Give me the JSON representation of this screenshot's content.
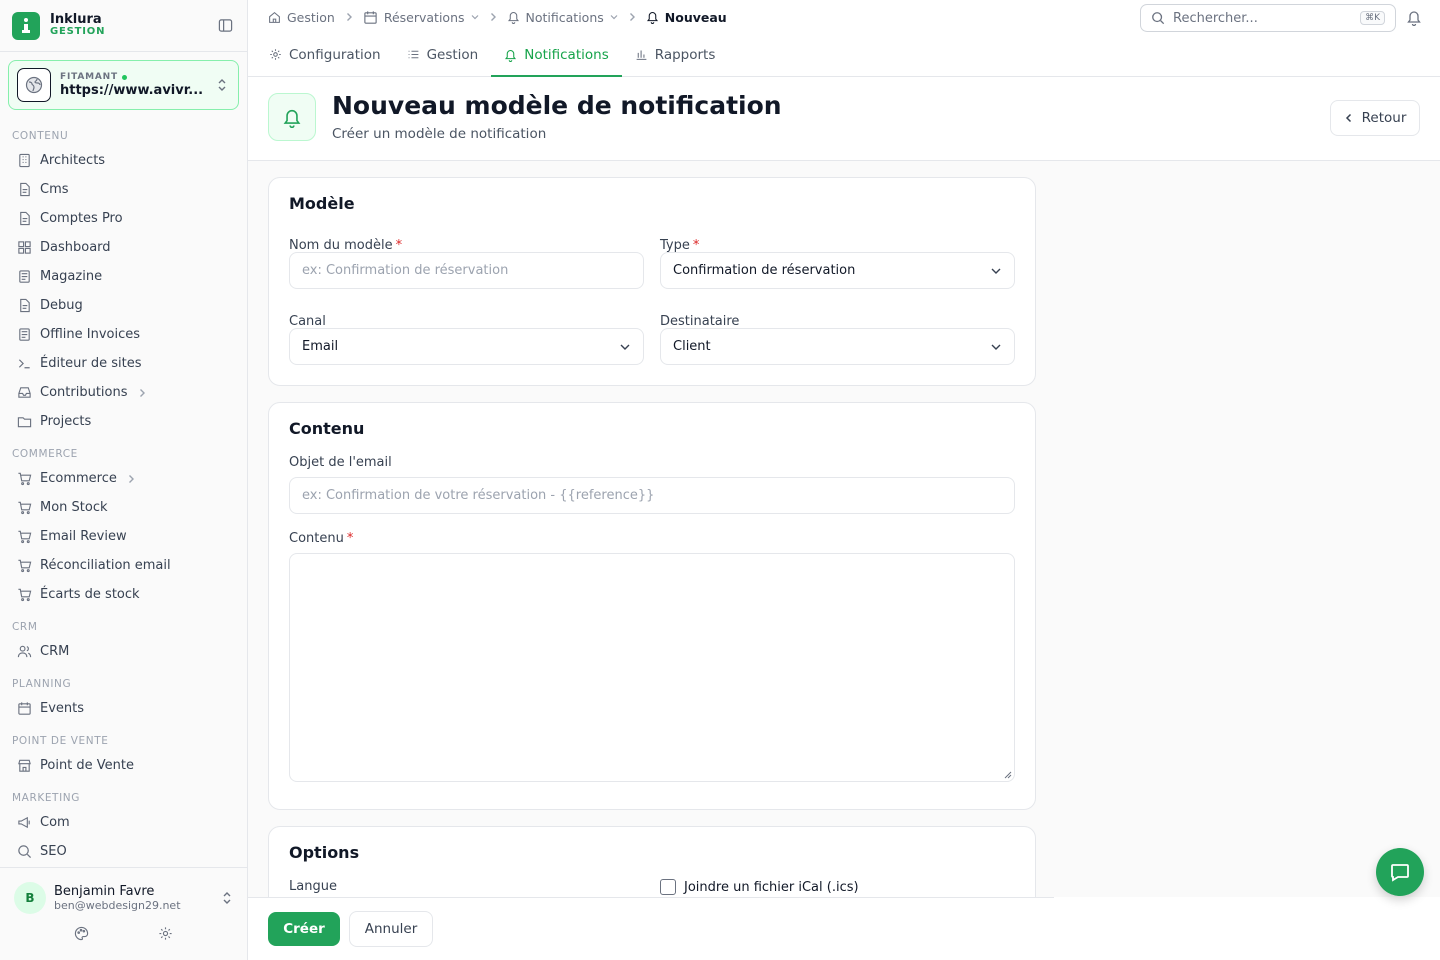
{
  "brand": {
    "name": "Inklura",
    "sub": "GESTION"
  },
  "site": {
    "label": "FITAMANT",
    "url": "https://www.avivr..."
  },
  "sidebar": {
    "sections": [
      {
        "title": "CONTENU",
        "items": [
          {
            "label": "Architects",
            "icon": "building-icon"
          },
          {
            "label": "Cms",
            "icon": "file-icon"
          },
          {
            "label": "Comptes Pro",
            "icon": "file-icon"
          },
          {
            "label": "Dashboard",
            "icon": "grid-icon"
          },
          {
            "label": "Magazine",
            "icon": "newspaper-icon"
          },
          {
            "label": "Debug",
            "icon": "file-icon"
          },
          {
            "label": "Offline Invoices",
            "icon": "newspaper-icon"
          },
          {
            "label": "Éditeur de sites",
            "icon": "terminal-icon"
          },
          {
            "label": "Contributions",
            "icon": "inbox-icon",
            "chevron": true
          },
          {
            "label": "Projects",
            "icon": "folder-icon"
          }
        ]
      },
      {
        "title": "COMMERCE",
        "items": [
          {
            "label": "Ecommerce",
            "icon": "cart-icon",
            "chevron": true
          },
          {
            "label": "Mon Stock",
            "icon": "cart-icon"
          },
          {
            "label": "Email Review",
            "icon": "cart-icon"
          },
          {
            "label": "Réconciliation email",
            "icon": "cart-icon"
          },
          {
            "label": "Écarts de stock",
            "icon": "cart-icon"
          }
        ]
      },
      {
        "title": "CRM",
        "items": [
          {
            "label": "CRM",
            "icon": "users-icon"
          }
        ]
      },
      {
        "title": "PLANNING",
        "items": [
          {
            "label": "Events",
            "icon": "calendar-icon"
          }
        ]
      },
      {
        "title": "POINT DE VENTE",
        "items": [
          {
            "label": "Point de Vente",
            "icon": "store-icon"
          }
        ]
      },
      {
        "title": "MARKETING",
        "items": [
          {
            "label": "Com",
            "icon": "megaphone-icon"
          },
          {
            "label": "SEO",
            "icon": "search-icon"
          }
        ]
      }
    ]
  },
  "user": {
    "initial": "B",
    "name": "Benjamin Favre",
    "email": "ben@webdesign29.net"
  },
  "breadcrumb": [
    {
      "label": "Gestion",
      "icon": "home-icon"
    },
    {
      "label": "Réservations",
      "icon": "calendar-icon",
      "dropdown": true
    },
    {
      "label": "Notifications",
      "icon": "bell-icon",
      "dropdown": true
    },
    {
      "label": "Nouveau",
      "icon": "bell-icon",
      "active": true
    }
  ],
  "search": {
    "placeholder": "Rechercher...",
    "shortcut": "⌘K"
  },
  "tabs": [
    {
      "label": "Configuration",
      "icon": "gear-icon"
    },
    {
      "label": "Gestion",
      "icon": "list-icon"
    },
    {
      "label": "Notifications",
      "icon": "bell-icon",
      "active": true
    },
    {
      "label": "Rapports",
      "icon": "bar-chart-icon"
    }
  ],
  "header": {
    "title": "Nouveau modèle de notification",
    "subtitle": "Créer un modèle de notification",
    "back_label": "Retour"
  },
  "form": {
    "modele": {
      "title": "Modèle",
      "name_label": "Nom du modèle",
      "name_placeholder": "ex: Confirmation de réservation",
      "type_label": "Type",
      "type_value": "Confirmation de réservation",
      "canal_label": "Canal",
      "canal_value": "Email",
      "dest_label": "Destinataire",
      "dest_value": "Client"
    },
    "contenu": {
      "title": "Contenu",
      "subject_label": "Objet de l'email",
      "subject_placeholder": "ex: Confirmation de votre réservation - {{reference}}",
      "body_label": "Contenu"
    },
    "options": {
      "title": "Options",
      "langue_label": "Langue",
      "ical_label": "Joindre un fichier iCal (.ics)"
    },
    "required_mark": "*"
  },
  "footer": {
    "submit": "Créer",
    "cancel": "Annuler"
  },
  "colors": {
    "accent": "#22a35a",
    "required": "#dc2626"
  }
}
